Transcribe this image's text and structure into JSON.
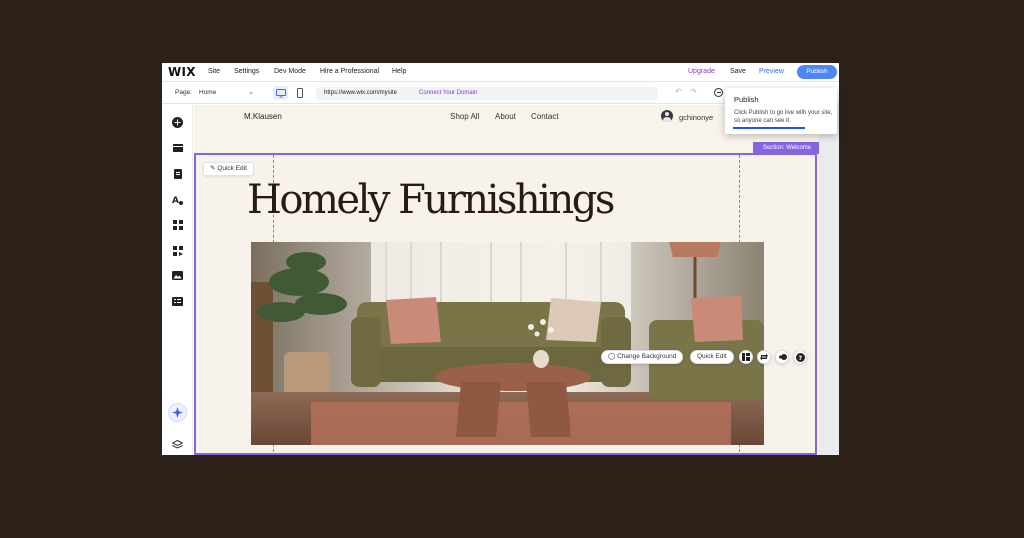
{
  "topbar": {
    "logo": "WIX",
    "menu": [
      "Site",
      "Settings",
      "Dev Mode",
      "Hire a Professional",
      "Help"
    ],
    "upgrade": "Upgrade",
    "save": "Save",
    "preview": "Preview",
    "publish": "Publish"
  },
  "toolbar": {
    "page_label": "Page:",
    "page_value": "Home",
    "url": "https://www.wix.com/mysite",
    "connect_domain": "Connect Your Domain"
  },
  "sidebar": {
    "icons": [
      "add-icon",
      "sections-icon",
      "pages-icon",
      "theme-icon",
      "apps-icon",
      "business-icon",
      "media-icon",
      "cms-icon",
      "ai-assistant-icon",
      "layers-icon"
    ]
  },
  "site": {
    "brand": "M.Klausen",
    "nav": [
      "Shop All",
      "About",
      "Contact"
    ],
    "user": "gchinonye",
    "section_tag": "Section: Welcome",
    "quick_edit": "Quick Edit",
    "heading": "Homely Furnishings"
  },
  "floating": {
    "change_background": "Change Background",
    "quick_edit": "Quick Edit"
  },
  "tooltip": {
    "title": "Publish",
    "body": "Click Publish to go live with your site, so anyone can see it."
  },
  "colors": {
    "accent": "#8366e0",
    "publish": "#4e86f6",
    "upgrade": "#7a3dd6",
    "canvas": "#f7f3ec",
    "backdrop": "#2b2118"
  }
}
